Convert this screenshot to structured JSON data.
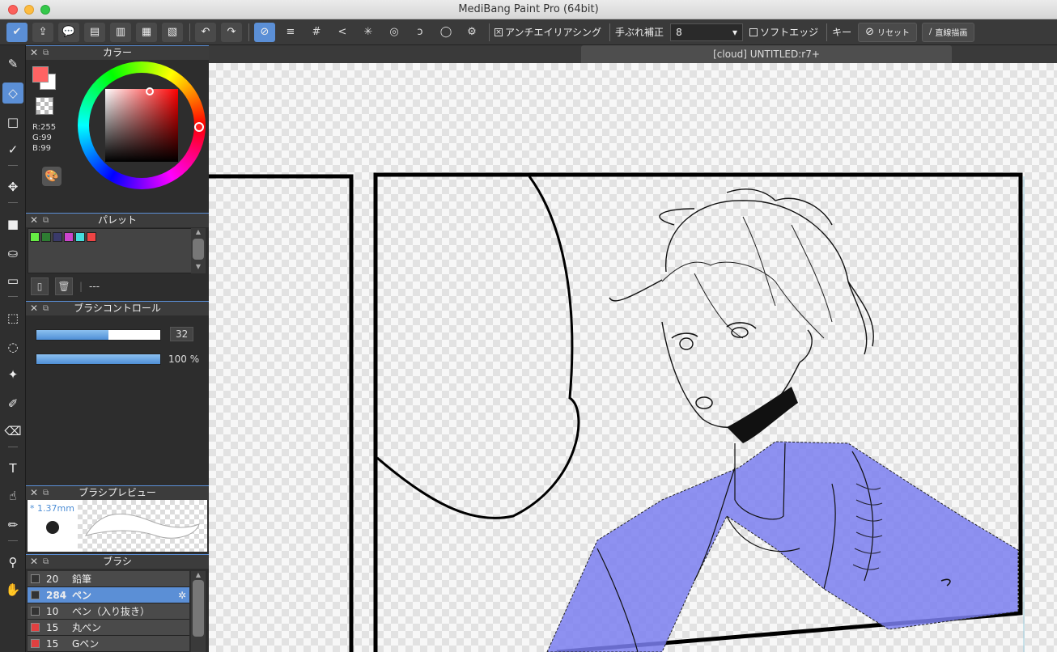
{
  "window": {
    "title": "MediBang Paint Pro (64bit)"
  },
  "toolbar": {
    "antialias_label": "アンチエイリアシング",
    "antialias_check": "×",
    "stabilizer_label": "手ぶれ補正",
    "stabilizer_value": "8",
    "softedge_label": "ソフトエッジ",
    "key_label": "キー",
    "reset_label": "リセット",
    "straight_label": "直線描画"
  },
  "document": {
    "tab_label": "[cloud] UNTITLED:r7+"
  },
  "panels": {
    "color": {
      "title": "カラー",
      "r": "R:255",
      "g": "G:99",
      "b": "B:99",
      "foreground": "#ff6363",
      "background": "#ffffff"
    },
    "palette": {
      "title": "パレット",
      "name": "---",
      "swatches": [
        "#66ee44",
        "#2e7d32",
        "#3a3a6a",
        "#cc44cc",
        "#44dddd",
        "#ee4444"
      ]
    },
    "brush_control": {
      "title": "ブラシコントロール",
      "size": "32",
      "opacity": "100 %",
      "size_fraction": 0.58,
      "opacity_fraction": 1.0
    },
    "brush_preview": {
      "title": "ブラシプレビュー",
      "size_label": "* 1.37mm"
    },
    "brush": {
      "title": "ブラシ",
      "items": [
        {
          "num": "20",
          "name": "鉛筆",
          "color": "#333333"
        },
        {
          "num": "284",
          "name": "ペン",
          "color": "#333333"
        },
        {
          "num": "10",
          "name": "ペン（入り抜き）",
          "color": "#333333"
        },
        {
          "num": "15",
          "name": "丸ペン",
          "color": "#e04040"
        },
        {
          "num": "15",
          "name": "Gペン",
          "color": "#e04040"
        }
      ]
    }
  },
  "accent": "#5b8fd6",
  "selection_fill": "#7b7ff0"
}
